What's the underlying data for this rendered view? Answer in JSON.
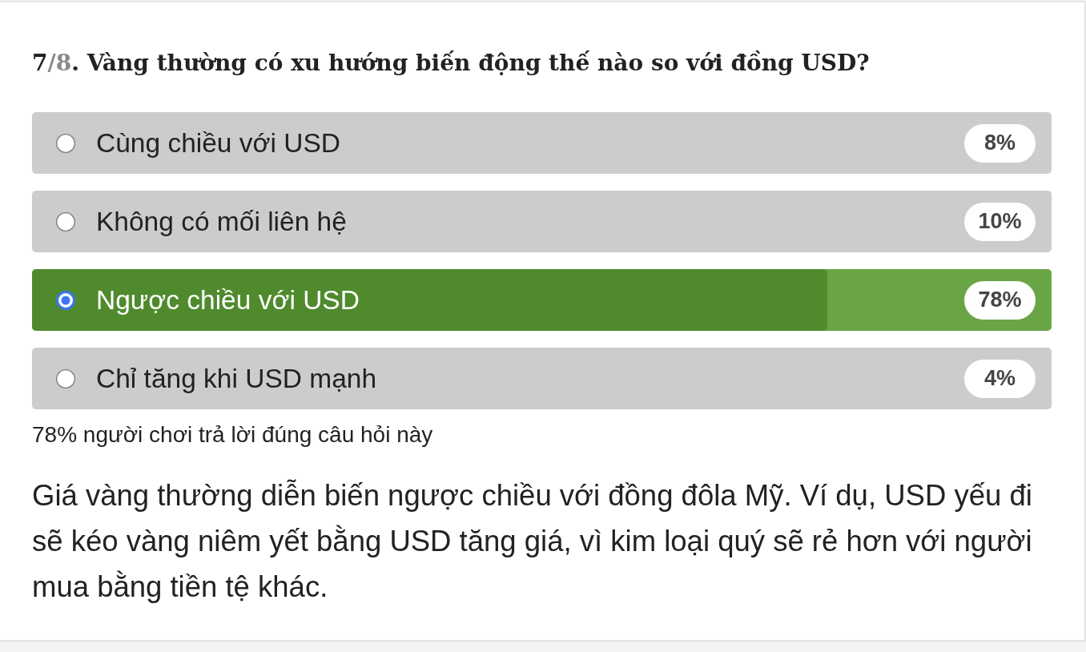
{
  "question": {
    "number": "7",
    "count": "/8",
    "text": ". Vàng thường có xu hướng biến động thế nào so với đồng USD?"
  },
  "options": [
    {
      "label": "Cùng chiều với USD",
      "percent": "8%",
      "selected": false,
      "correct": false
    },
    {
      "label": "Không có mối liên hệ",
      "percent": "10%",
      "selected": false,
      "correct": false
    },
    {
      "label": "Ngược chiều với USD",
      "percent": "78%",
      "selected": true,
      "correct": true,
      "level": 0.78
    },
    {
      "label": "Chỉ tăng khi USD mạnh",
      "percent": "4%",
      "selected": false,
      "correct": false
    }
  ],
  "stats": "78% người chơi trả lời đúng câu hỏi này",
  "explanation": "Giá vàng thường diễn biến ngược chiều với đồng đôla Mỹ. Ví dụ, USD yếu đi sẽ kéo vàng niêm yết bằng USD tăng giá, vì kim loại quý sẽ rẻ hơn với người mua bằng tiền tệ khác."
}
